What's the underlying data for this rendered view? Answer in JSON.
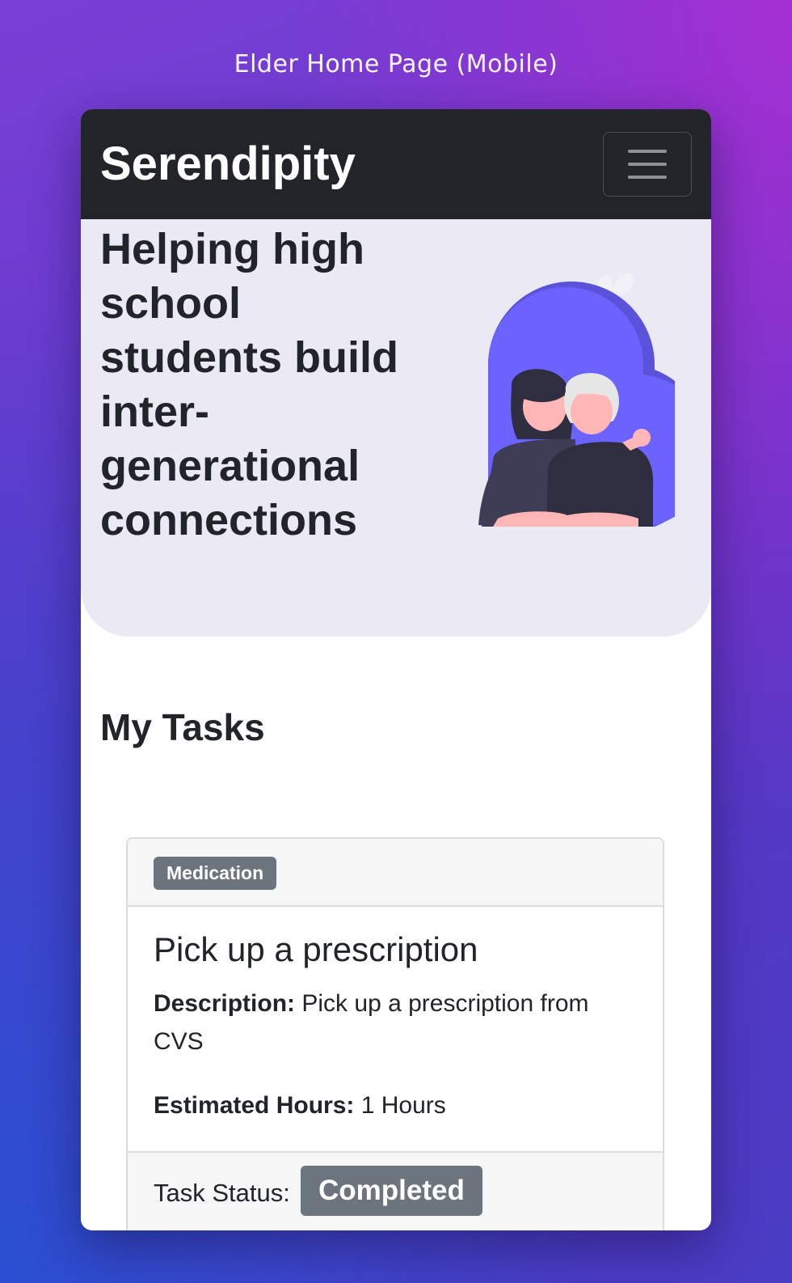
{
  "caption": "Elder Home Page (Mobile)",
  "navbar": {
    "brand": "Serendipity",
    "toggler_icon": "hamburger-menu-icon"
  },
  "hero": {
    "title": "Helping high school students build inter-generational connections",
    "illustration": "heart-with-two-people-illustration"
  },
  "tasks": {
    "heading": "My Tasks",
    "items": [
      {
        "category": "Medication",
        "title": "Pick up a prescription",
        "description_label": "Description:",
        "description": "Pick up a prescription from CVS",
        "hours_label": "Estimated Hours:",
        "hours": "1 Hours",
        "status_label": "Task Status:",
        "status": "Completed"
      }
    ]
  },
  "colors": {
    "navbar_bg": "#212529",
    "hero_bg": "#ebe9f3",
    "heart": "#6c63ff",
    "badge": "#6c757d",
    "text": "#212529"
  }
}
